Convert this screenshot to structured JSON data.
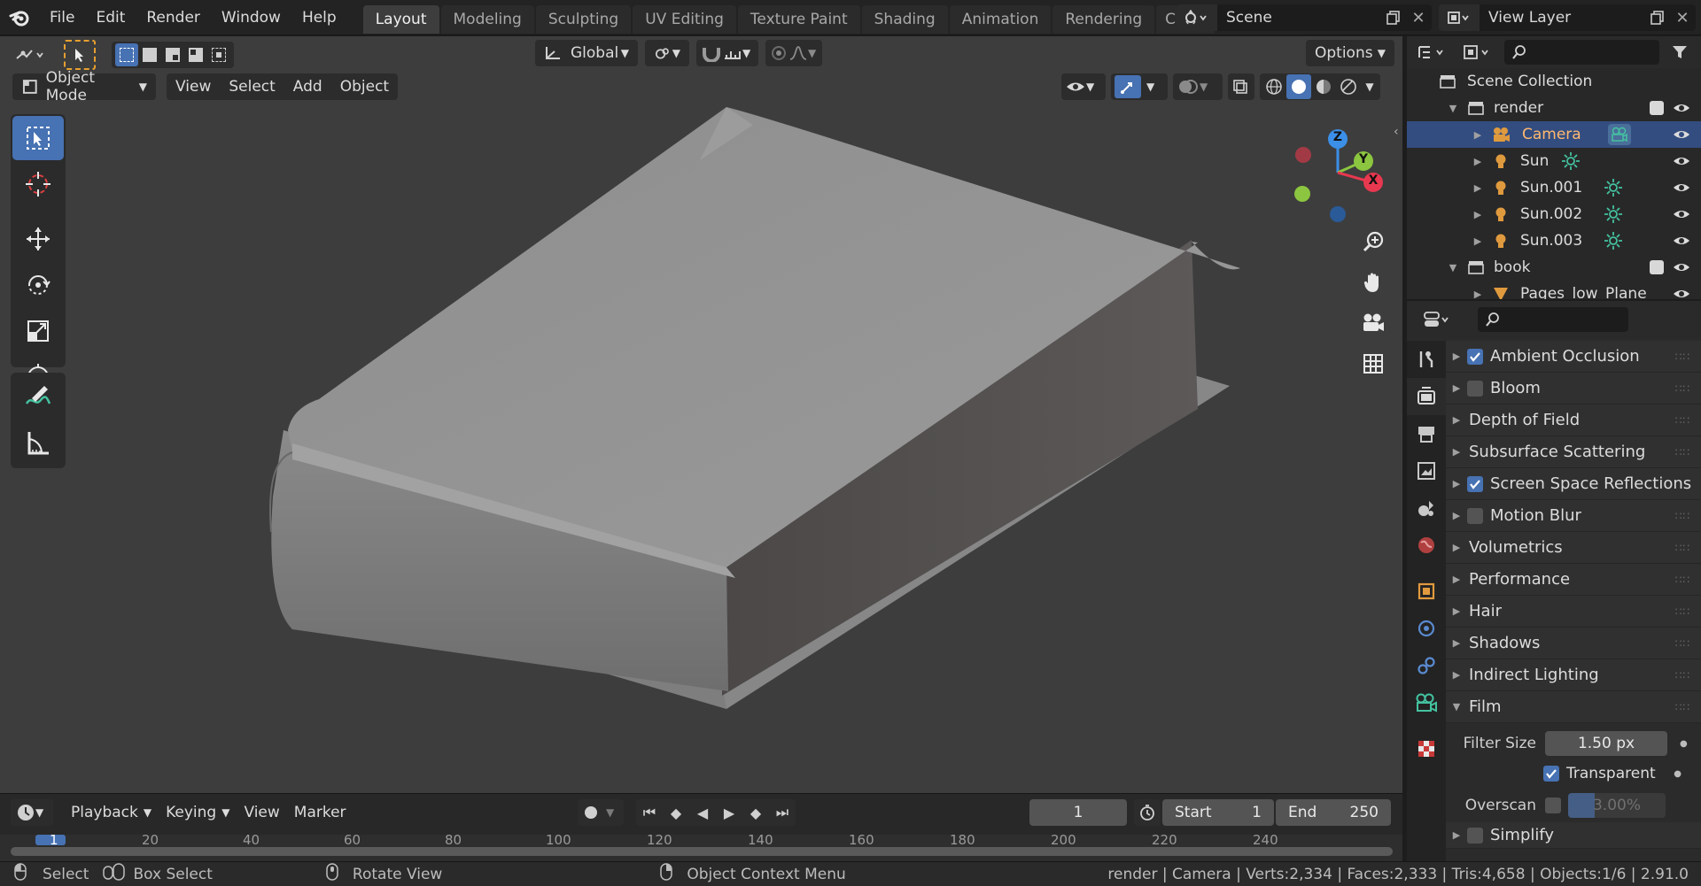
{
  "topbar": {
    "menus": [
      "File",
      "Edit",
      "Render",
      "Window",
      "Help"
    ],
    "tabs": [
      {
        "label": "Layout",
        "active": true
      },
      {
        "label": "Modeling"
      },
      {
        "label": "Sculpting"
      },
      {
        "label": "UV Editing"
      },
      {
        "label": "Texture Paint"
      },
      {
        "label": "Shading"
      },
      {
        "label": "Animation"
      },
      {
        "label": "Rendering"
      },
      {
        "label": "Compos"
      }
    ],
    "scene": "Scene",
    "view_layer": "View Layer"
  },
  "viewport": {
    "orientation": "Global",
    "options_label": "Options",
    "mode": "Object Mode",
    "menus": [
      "View",
      "Select",
      "Add",
      "Object"
    ],
    "gizmo_axes": [
      "Z",
      "Y",
      "X"
    ]
  },
  "timeline": {
    "menus": [
      "Playback",
      "Keying",
      "View",
      "Marker"
    ],
    "current_frame": "1",
    "start_label": "Start",
    "start_value": "1",
    "end_label": "End",
    "end_value": "250",
    "ruler_ticks": [
      "1",
      "20",
      "40",
      "60",
      "80",
      "100",
      "120",
      "140",
      "160",
      "180",
      "200",
      "220",
      "240"
    ]
  },
  "statusbar": {
    "select": "Select",
    "box_select": "Box Select",
    "rotate_view": "Rotate View",
    "context_menu": "Object Context Menu",
    "info": "render | Camera | Verts:2,334 | Faces:2,333 | Tris:4,658 | Objects:1/6 | 2.91.0"
  },
  "outliner": {
    "root": "Scene Collection",
    "items": [
      {
        "label": "render",
        "type": "collection",
        "level": 1,
        "expanded": true
      },
      {
        "label": "Camera",
        "type": "camera",
        "level": 2,
        "selected": true
      },
      {
        "label": "Sun",
        "type": "light",
        "level": 2
      },
      {
        "label": "Sun.001",
        "type": "light",
        "level": 2
      },
      {
        "label": "Sun.002",
        "type": "light",
        "level": 2
      },
      {
        "label": "Sun.003",
        "type": "light",
        "level": 2
      },
      {
        "label": "book",
        "type": "collection",
        "level": 1,
        "expanded": true
      },
      {
        "label": "Pages_low_Plane",
        "type": "mesh",
        "level": 2
      }
    ]
  },
  "properties": {
    "panels": [
      {
        "label": "Ambient Occlusion",
        "checkbox": true,
        "checked": true
      },
      {
        "label": "Bloom",
        "checkbox": true,
        "checked": false
      },
      {
        "label": "Depth of Field"
      },
      {
        "label": "Subsurface Scattering"
      },
      {
        "label": "Screen Space Reflections",
        "checkbox": true,
        "checked": true
      },
      {
        "label": "Motion Blur",
        "checkbox": true,
        "checked": false
      },
      {
        "label": "Volumetrics"
      },
      {
        "label": "Performance"
      },
      {
        "label": "Hair"
      },
      {
        "label": "Shadows"
      },
      {
        "label": "Indirect Lighting"
      },
      {
        "label": "Film",
        "expanded": true
      }
    ],
    "film": {
      "filter_size_label": "Filter Size",
      "filter_size_value": "1.50 px",
      "transparent_label": "Transparent",
      "transparent_checked": true,
      "overscan_label": "Overscan",
      "overscan_value": "3.00%"
    },
    "next_panel": "Simplify"
  },
  "colors": {
    "accent": "#4772b3",
    "selected_row": "#334d80",
    "axis_x": "#e8384f",
    "axis_y": "#8cc640",
    "axis_z": "#3b8fe8",
    "light_icon": "#e09a3e",
    "camera_icon": "#e09a3e",
    "light_data": "#44c2a0"
  }
}
